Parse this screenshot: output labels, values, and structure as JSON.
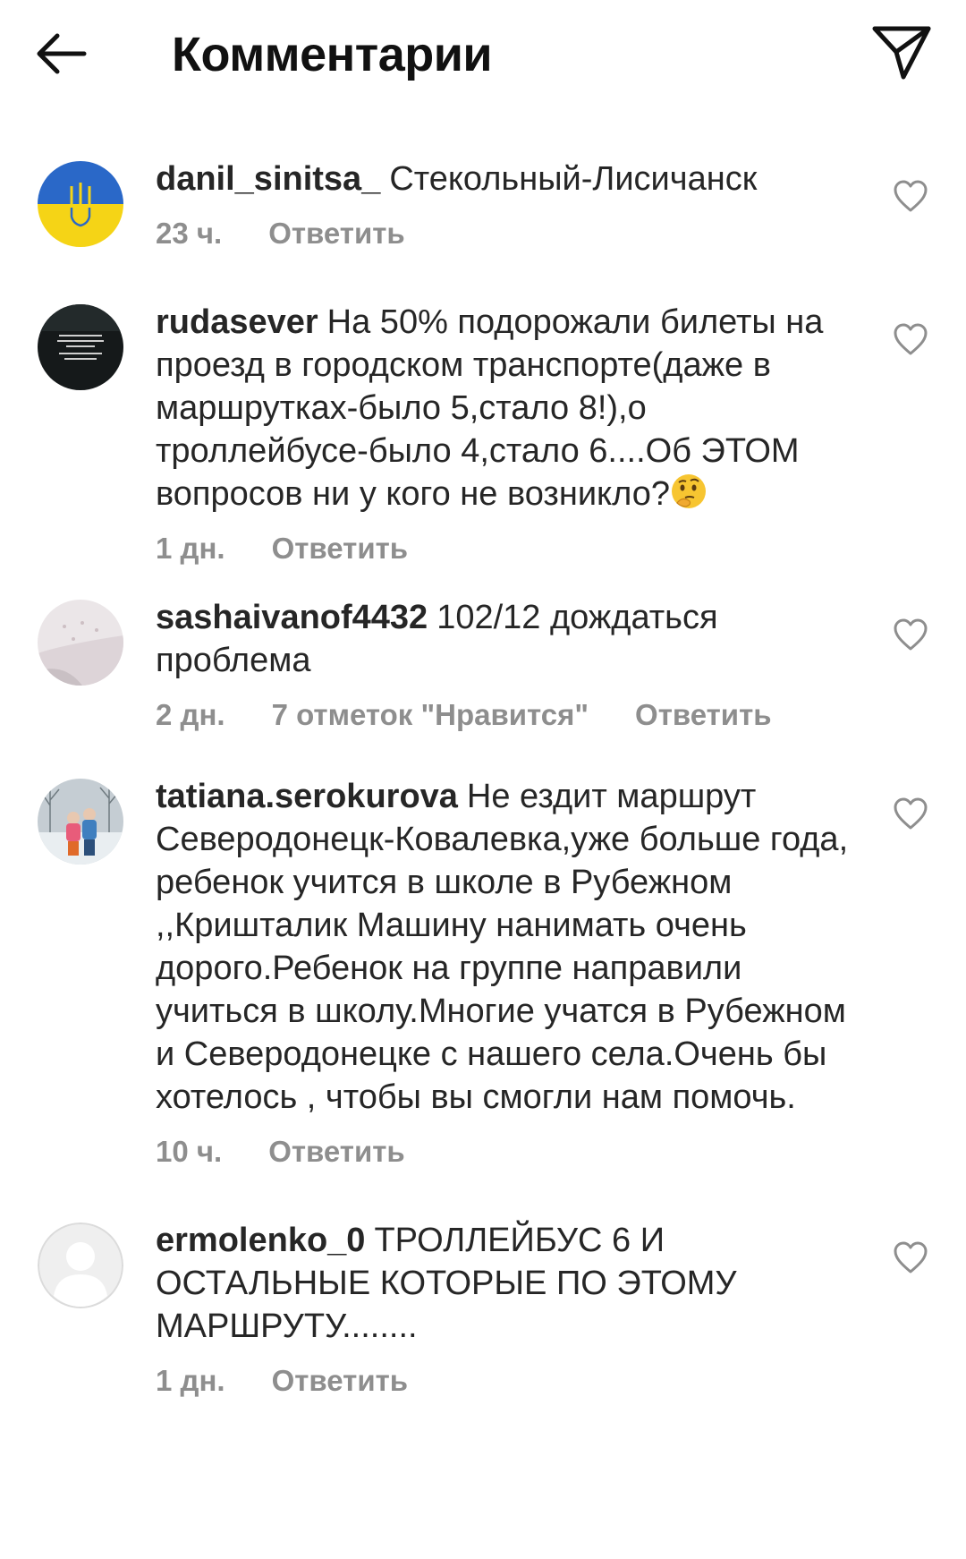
{
  "header": {
    "title": "Комментарии",
    "back_icon": "arrow-left-icon",
    "send_icon": "paper-plane-icon"
  },
  "comments": [
    {
      "username": "danil_sinitsa_",
      "text": "Стекольный-Лисичанск",
      "time": "23 ч.",
      "likes": "",
      "reply": "Ответить",
      "avatar": "ukraine-trident-avatar"
    },
    {
      "username": "rudasever",
      "text": "На 50% подорожали билеты на проезд в городском транспорте(даже в маршрутках-было 5,стало 8!),о троллейбусе-было 4,стало 6....Об ЭТОМ вопросов ни у кого не возникло?",
      "emoji": "thinking-face-emoji",
      "time": "1 дн.",
      "likes": "",
      "reply": "Ответить",
      "avatar": "dark-quote-avatar"
    },
    {
      "username": "sashaivanof4432",
      "text": "102/12 дождаться проблема",
      "time": "2 дн.",
      "likes": "7 отметок \"Нравится\"",
      "reply": "Ответить",
      "avatar": "light-photo-avatar"
    },
    {
      "username": "tatiana.serokurova",
      "text": "Не ездит маршрут Северодонецк-Ковалевка,уже больше года, ребенок учится в школе в Рубежном ,,Кришталик Машину нанимать очень дорого.Ребенок на группе направили учиться в школу.Многие  учатся в Рубежном и Северодонецке с нашего села.Очень бы хотелось , чтобы вы смогли нам помочь.",
      "time": "10 ч.",
      "likes": "",
      "reply": "Ответить",
      "avatar": "winter-children-avatar"
    },
    {
      "username": "ermolenko_0",
      "text": "ТРОЛЛЕЙБУС 6 И ОСТАЛЬНЫЕ КОТОРЫЕ ПО ЭТОМУ МАРШРУТУ........",
      "time": "1 дн.",
      "likes": "",
      "reply": "Ответить",
      "avatar": "default-user-avatar"
    }
  ],
  "colors": {
    "text": "#262626",
    "meta": "#8e8e8e",
    "background": "#ffffff"
  }
}
